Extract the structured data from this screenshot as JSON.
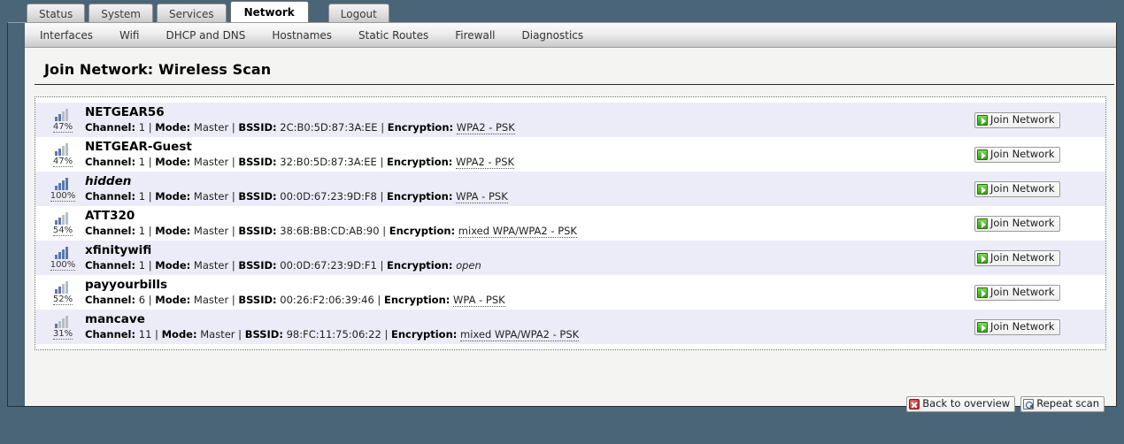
{
  "tabs": [
    {
      "label": "Status",
      "active": false
    },
    {
      "label": "System",
      "active": false
    },
    {
      "label": "Services",
      "active": false
    },
    {
      "label": "Network",
      "active": true
    },
    {
      "label": "Logout",
      "active": false
    }
  ],
  "subnav": [
    {
      "label": "Interfaces"
    },
    {
      "label": "Wifi"
    },
    {
      "label": "DHCP and DNS"
    },
    {
      "label": "Hostnames"
    },
    {
      "label": "Static Routes"
    },
    {
      "label": "Firewall"
    },
    {
      "label": "Diagnostics"
    }
  ],
  "page": {
    "title": "Join Network: Wireless Scan"
  },
  "labels": {
    "channel": "Channel:",
    "mode": "Mode:",
    "bssid": "BSSID:",
    "encryption": "Encryption:",
    "separator": "|",
    "join": "Join Network",
    "back": "Back to overview",
    "repeat": "Repeat scan"
  },
  "networks": [
    {
      "ssid": "NETGEAR56",
      "hidden": false,
      "signal": "47%",
      "bars": 2,
      "channel": "1",
      "mode": "Master",
      "bssid": "2C:B0:5D:87:3A:EE",
      "encryption": "WPA2 - PSK",
      "open": false,
      "join_label": "Join Network"
    },
    {
      "ssid": "NETGEAR-Guest",
      "hidden": false,
      "signal": "47%",
      "bars": 2,
      "channel": "1",
      "mode": "Master",
      "bssid": "32:B0:5D:87:3A:EE",
      "encryption": "WPA2 - PSK",
      "open": false,
      "join_label": "Join Network"
    },
    {
      "ssid": "hidden",
      "hidden": true,
      "signal": "100%",
      "bars": 4,
      "channel": "1",
      "mode": "Master",
      "bssid": "00:0D:67:23:9D:F8",
      "encryption": "WPA - PSK",
      "open": false,
      "join_label": "Join Network"
    },
    {
      "ssid": "ATT320",
      "hidden": false,
      "signal": "54%",
      "bars": 2,
      "channel": "1",
      "mode": "Master",
      "bssid": "38:6B:BB:CD:AB:90",
      "encryption": "mixed WPA/WPA2 - PSK",
      "open": false,
      "join_label": "Join Network"
    },
    {
      "ssid": "xfinitywifi",
      "hidden": false,
      "signal": "100%",
      "bars": 4,
      "channel": "1",
      "mode": "Master",
      "bssid": "00:0D:67:23:9D:F1",
      "encryption": "open",
      "open": true,
      "join_label": "Join Network"
    },
    {
      "ssid": "payyourbills",
      "hidden": false,
      "signal": "52%",
      "bars": 2,
      "channel": "6",
      "mode": "Master",
      "bssid": "00:26:F2:06:39:46",
      "encryption": "WPA - PSK",
      "open": false,
      "join_label": "Join Network"
    },
    {
      "ssid": "mancave",
      "hidden": false,
      "signal": "31%",
      "bars": 1,
      "channel": "11",
      "mode": "Master",
      "bssid": "98:FC:11:75:06:22",
      "encryption": "mixed WPA/WPA2 - PSK",
      "open": false,
      "join_label": "Join Network"
    }
  ],
  "colors": {
    "chrome": "#4a6577",
    "row_alt": "#ececf8",
    "signal_on": "#5b77ae",
    "signal_off": "#b9bdc4",
    "join_icon": "#35a116",
    "back_icon": "#b62424"
  }
}
